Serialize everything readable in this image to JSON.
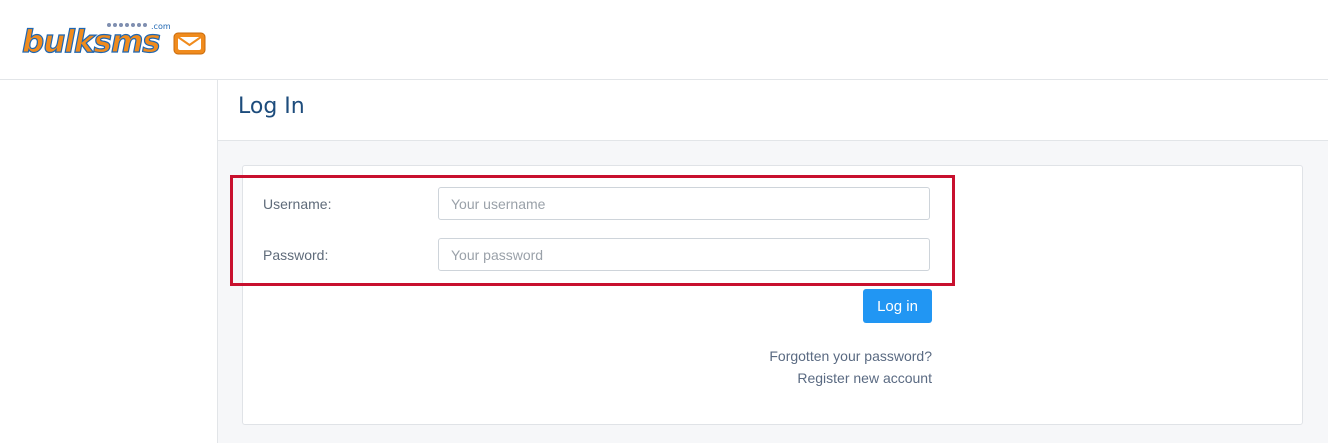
{
  "brand": {
    "logo_text": "bulksms",
    "logo_suffix": ".com",
    "colors": {
      "blue": "#1e66b2",
      "orange": "#f08b1d"
    }
  },
  "page": {
    "title": "Log In"
  },
  "form": {
    "username_label": "Username:",
    "username_placeholder": "Your username",
    "password_label": "Password:",
    "password_placeholder": "Your password",
    "submit_label": "Log in"
  },
  "links": {
    "forgot_password": "Forgotten your password?",
    "register": "Register new account"
  },
  "colors": {
    "accent": "#2196f3",
    "title": "#1d4c7c",
    "highlight_border": "#c8102e"
  }
}
